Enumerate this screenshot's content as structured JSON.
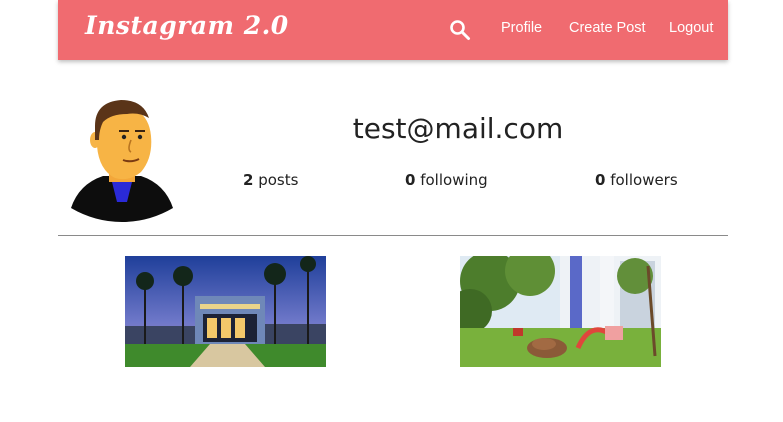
{
  "nav": {
    "brand": "Instagram 2.0",
    "search_icon": "search-icon",
    "links": [
      "Profile",
      "Create Post",
      "Logout"
    ]
  },
  "profile": {
    "avatar_icon": "avatar",
    "email": "test@mail.com",
    "stats": {
      "posts_count": "2",
      "posts_label": "posts",
      "following_count": "0",
      "following_label": "following",
      "followers_count": "0",
      "followers_label": "followers"
    }
  },
  "posts": [
    {
      "image": "post-image"
    },
    {
      "image": "post-image"
    }
  ],
  "colors": {
    "navbar": "#f06b70",
    "text": "#222222",
    "divider": "#8a8a8a"
  }
}
